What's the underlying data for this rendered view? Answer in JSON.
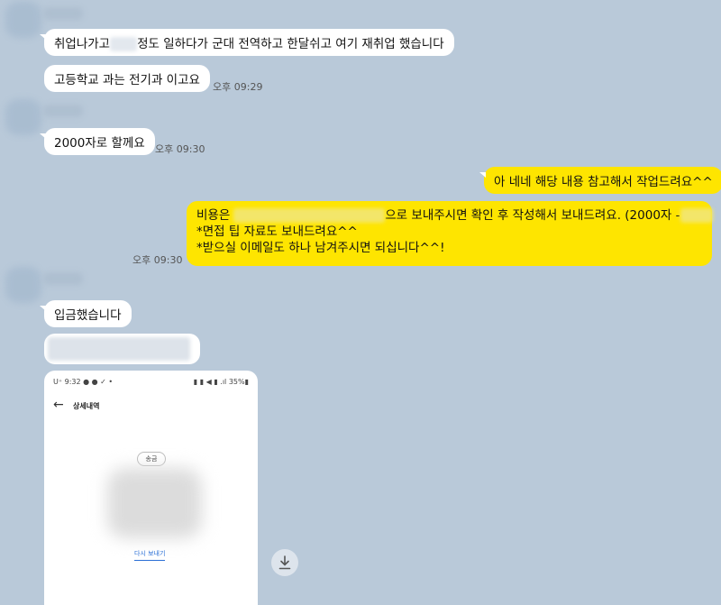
{
  "messages": {
    "m1": "취업나가고",
    "m1_suffix": "정도 일하다가 군대 전역하고 한달쉬고 여기 재취업 했습니다",
    "m2": "고등학교 과는 전기과 이고요",
    "m2_time": "오후 09:29",
    "m3": "2000자로 할께요",
    "m3_time": "오후 09:30",
    "m4": "아 네네 해당 내용 참고해서 작업드려요^^",
    "m5_prefix": "비용은",
    "m5_suffix": "으로 보내주시면 확인 후 작성해서 보내드려요. (2000자 -",
    "m5_line2": "*면접 팁 자료도 보내드려요^^",
    "m5_line3": "*받으실 이메일도 하나 남겨주시면 되십니다^^!",
    "m5_time": "오후 09:30",
    "m6": "입금했습니다"
  },
  "screenshot": {
    "status_left": "U⁺ 9:32 ● ● ✓ •",
    "status_right": "▮ ▮ ◀ ▮ .ıl 35%▮",
    "title": "상세내역",
    "pill": "송금",
    "resend": "다시 보내기"
  },
  "icons": {
    "back": "arrow-left-icon",
    "download": "download-icon"
  },
  "colors": {
    "background": "#b9c9d9",
    "my_bubble": "#fee500",
    "their_bubble": "#ffffff"
  }
}
